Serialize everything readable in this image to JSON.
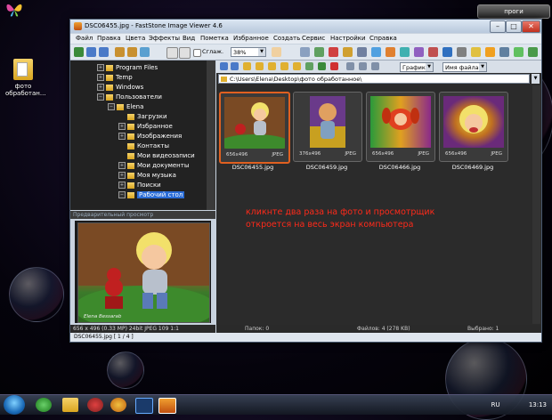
{
  "desktop": {
    "icon_label_line1": "фото",
    "icon_label_line2": "обработан...",
    "top_button": "проги"
  },
  "window": {
    "title": "DSC06455.jpg  -  FastStone Image Viewer 4.6",
    "minimize": "–",
    "maximize": "□",
    "close": "✕"
  },
  "menu": [
    "Файл",
    "Правка",
    "Цвета",
    "Эффекты",
    "Вид",
    "Пометка",
    "Избранное",
    "Создать",
    "Сервис",
    "Настройки",
    "Справка"
  ],
  "toolbar": {
    "zoom_value": "38%",
    "smooth_label": "Сглаж.",
    "sort_type": "Графика",
    "sort_by": "Имя файла"
  },
  "tree": [
    {
      "label": "Program Files",
      "indent": 0,
      "toggle": "+"
    },
    {
      "label": "Temp",
      "indent": 0,
      "toggle": "+"
    },
    {
      "label": "Windows",
      "indent": 0,
      "toggle": "+"
    },
    {
      "label": "Пользователи",
      "indent": 0,
      "toggle": "−"
    },
    {
      "label": "Elena",
      "indent": 1,
      "toggle": "−"
    },
    {
      "label": "Загрузки",
      "indent": 2,
      "toggle": ""
    },
    {
      "label": "Избранное",
      "indent": 2,
      "toggle": "+"
    },
    {
      "label": "Изображения",
      "indent": 2,
      "toggle": "+"
    },
    {
      "label": "Контакты",
      "indent": 2,
      "toggle": ""
    },
    {
      "label": "Мои видеозаписи",
      "indent": 2,
      "toggle": ""
    },
    {
      "label": "Мои документы",
      "indent": 2,
      "toggle": "+"
    },
    {
      "label": "Моя музыка",
      "indent": 2,
      "toggle": "+"
    },
    {
      "label": "Поиски",
      "indent": 2,
      "toggle": "+"
    },
    {
      "label": "Рабочий стол",
      "indent": 2,
      "toggle": "−",
      "selected": true
    }
  ],
  "preview": {
    "header": "Предварительный просмотр",
    "watermark": "Elena Bessarab",
    "status": "656 x 496 (0.33 MP)  24bit  JPEG  109  1:1"
  },
  "path": "C:\\Users\\Elena\\Desktop\\фото обработанное\\",
  "thumbnails": [
    {
      "name": "DSC06455.jpg",
      "dims": "656x496",
      "format": "JPEG",
      "selected": true
    },
    {
      "name": "DSC06459.jpg",
      "dims": "376x496",
      "format": "JPEG",
      "selected": false
    },
    {
      "name": "DSC06466.jpg",
      "dims": "656x496",
      "format": "JPEG",
      "selected": false
    },
    {
      "name": "DSC06469.jpg",
      "dims": "656x496",
      "format": "JPEG",
      "selected": false
    }
  ],
  "annotation": {
    "line1": "кликнте два раза на фото и просмотрщик",
    "line2": "откроется на весь экран компьютера"
  },
  "status": {
    "folders": "Папок: 0",
    "files": "Файлов: 4 (278 KB)",
    "selected": "Выбрано: 1"
  },
  "bottom": {
    "file_info": "DSC06455.jpg [ 1 / 4 ]"
  },
  "taskbar": {
    "lang": "RU",
    "time": "13:13"
  }
}
